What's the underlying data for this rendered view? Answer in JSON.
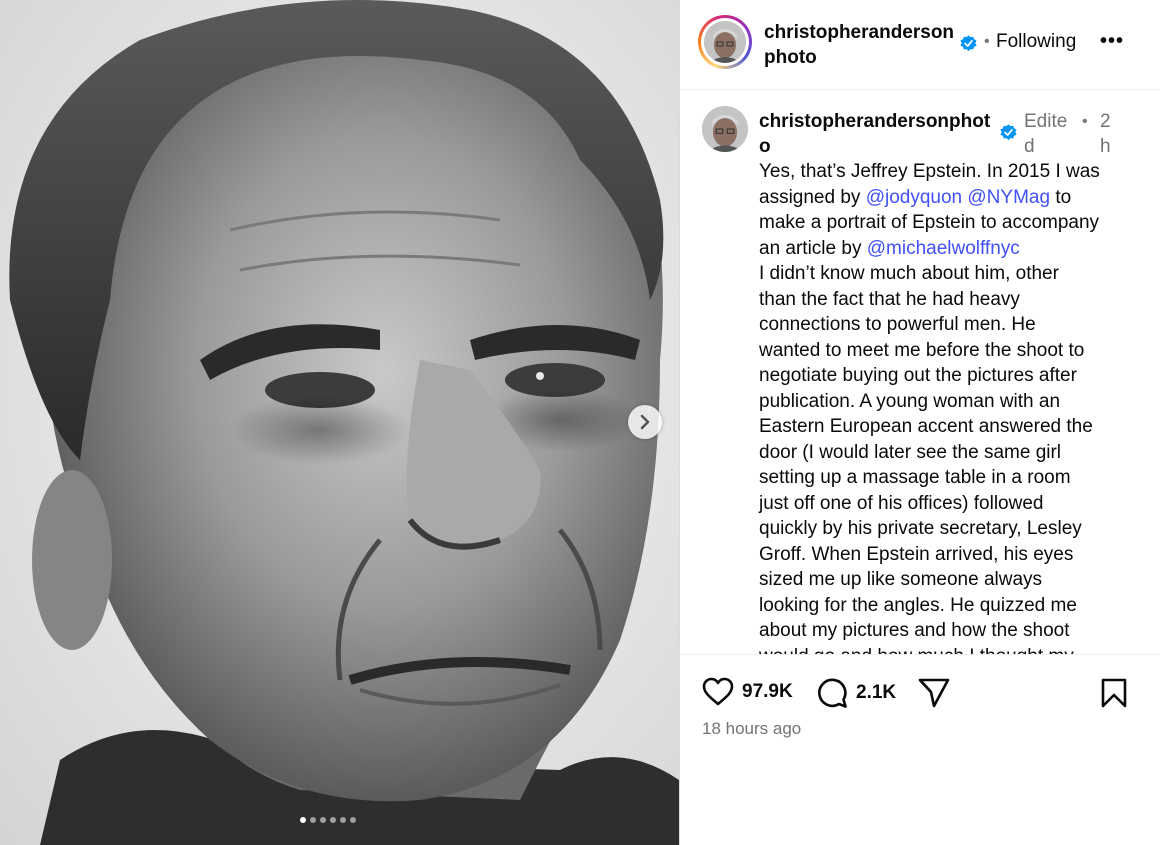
{
  "post": {
    "header": {
      "username": "christopherandersonphoto",
      "follow_label": "Following",
      "separator": "•",
      "more_label": "•••"
    },
    "caption": {
      "username": "christopherandersonphoto",
      "edited": "Edited",
      "separator": "•",
      "time": "2h",
      "lines": [
        [
          {
            "t": "Yes, that’s Jeffrey Epstein. In 2015 I was"
          }
        ],
        [
          {
            "t": "assigned by "
          },
          {
            "t": "@jodyquon",
            "m": true
          },
          {
            "t": " "
          },
          {
            "t": "@NYMag",
            "m": true
          },
          {
            "t": " to"
          }
        ],
        [
          {
            "t": "make a portrait of Epstein to accompany"
          }
        ],
        [
          {
            "t": "an article by "
          },
          {
            "t": "@michaelwolffnyc",
            "m": true
          }
        ],
        [
          {
            "t": "I didn’t know much about him, other"
          }
        ],
        [
          {
            "t": "than the fact that he had heavy"
          }
        ],
        [
          {
            "t": "connections to powerful men. He"
          }
        ],
        [
          {
            "t": "wanted to meet me before the shoot to"
          }
        ],
        [
          {
            "t": "negotiate buying out the pictures after"
          }
        ],
        [
          {
            "t": "publication. A young woman with an"
          }
        ],
        [
          {
            "t": "Eastern European accent answered the"
          }
        ],
        [
          {
            "t": "door (I would later see the same girl"
          }
        ],
        [
          {
            "t": "setting up a massage table in a room"
          }
        ],
        [
          {
            "t": "just off one of his offices) followed"
          }
        ],
        [
          {
            "t": "quickly by his private secretary, Lesley"
          }
        ],
        [
          {
            "t": "Groff. When Epstein arrived, his eyes"
          }
        ],
        [
          {
            "t": "sized me up like someone always"
          }
        ],
        [
          {
            "t": "looking for the angles. He quizzed me"
          }
        ],
        [
          {
            "t": "about my pictures and how the shoot"
          }
        ],
        [
          {
            "t": "would go and how much I thought my"
          }
        ]
      ]
    },
    "actions": {
      "like_icon": "heart-icon",
      "likes": "97.9K",
      "comment_icon": "comment-icon",
      "comments": "2.1K",
      "share_icon": "paper-plane-icon",
      "save_icon": "bookmark-icon"
    },
    "timestamp": "18 hours ago",
    "carousel": {
      "active_index": 1,
      "total": 6,
      "next_icon": "chevron-right-icon"
    }
  },
  "colors": {
    "mention": "#4150f7",
    "verified": "#0095f6",
    "muted": "#737373"
  }
}
